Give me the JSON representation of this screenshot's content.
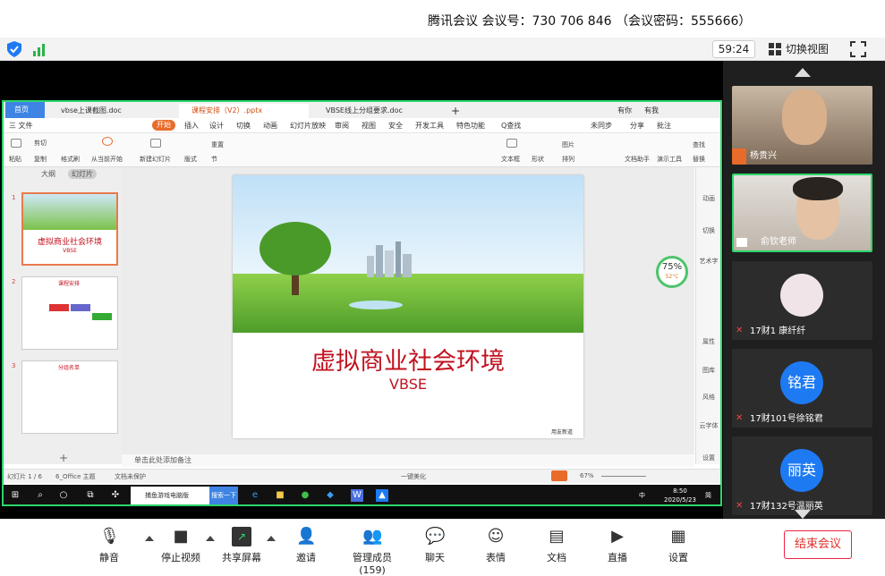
{
  "meeting_info": "腾讯会议 会议号：730 706 846 （会议密码：555666）",
  "timer": "59:24",
  "switch_view": "切换视图",
  "tabs": [
    "首页",
    "vbse上课截图.doc",
    "课程安排（V2）.pptx",
    "VBSE线上分组要求.doc"
  ],
  "tab_extra": [
    "有你",
    "有我"
  ],
  "menu_items": [
    "三 文件",
    "开始",
    "插入",
    "设计",
    "切换",
    "动画",
    "幻灯片放映",
    "审阅",
    "视图",
    "安全",
    "开发工具",
    "特色功能",
    "Q查找",
    "未同步",
    "分享",
    "批注"
  ],
  "ribbon": [
    "粘贴",
    "剪切",
    "复制",
    "格式刷",
    "从当前开始",
    "新建幻灯片",
    "版式",
    "节",
    "重置",
    "文本框",
    "形状",
    "图片",
    "排列",
    "文档助手",
    "演示工具",
    "查找",
    "替换"
  ],
  "pane_tabs": [
    "大纲",
    "幻灯片"
  ],
  "thumbnails": [
    {
      "num": "1",
      "title": "虚拟商业社会环境",
      "sub": "VBSE"
    },
    {
      "num": "2",
      "title": "课程安排"
    },
    {
      "num": "3",
      "title": "分组名单"
    }
  ],
  "slide": {
    "title": "虚拟商业社会环境",
    "subtitle": "VBSE",
    "brand": "用友新道"
  },
  "gauge": {
    "value": "75%",
    "temp": "52°C"
  },
  "right_tools": [
    "动画",
    "切换",
    "艺术字",
    "属性",
    "图库",
    "风格",
    "云字体",
    "设置"
  ],
  "notes": "单击此处添加备注",
  "status": {
    "slide": "幻灯片 1 / 6",
    "theme": "6_Office 主题",
    "protect": "文档未保护",
    "beautify": "一键美化",
    "zoom": "67%"
  },
  "taskbar": {
    "search": "捕鱼游戏电脑版",
    "search_btn": "搜索一下",
    "time": "8:50",
    "date": "2020/5/23",
    "ime": "中",
    "lang": "简"
  },
  "participants": [
    {
      "name": "杨贵兴",
      "video": true,
      "muted": false
    },
    {
      "name": "俞钦老师",
      "video": true,
      "muted": false,
      "speaking": true
    },
    {
      "name": "17财1 康纤纤",
      "avatar": "",
      "muted": true
    },
    {
      "name": "17财101号徐铭君",
      "avatar": "铭君",
      "muted": true
    },
    {
      "name": "17财132号温丽英",
      "avatar": "丽英",
      "muted": true
    }
  ],
  "toolbar": [
    "静音",
    "停止视频",
    "共享屏幕",
    "邀请",
    "管理成员(159)",
    "聊天",
    "表情",
    "文档",
    "直播",
    "设置"
  ],
  "end_meeting": "结束会议",
  "colors": {
    "accent_green": "#2bd66b",
    "end_red": "#e0302a",
    "wps_orange": "#e86b2a",
    "avatar_blue": "#1d7af3",
    "slide_red": "#c1121f"
  }
}
